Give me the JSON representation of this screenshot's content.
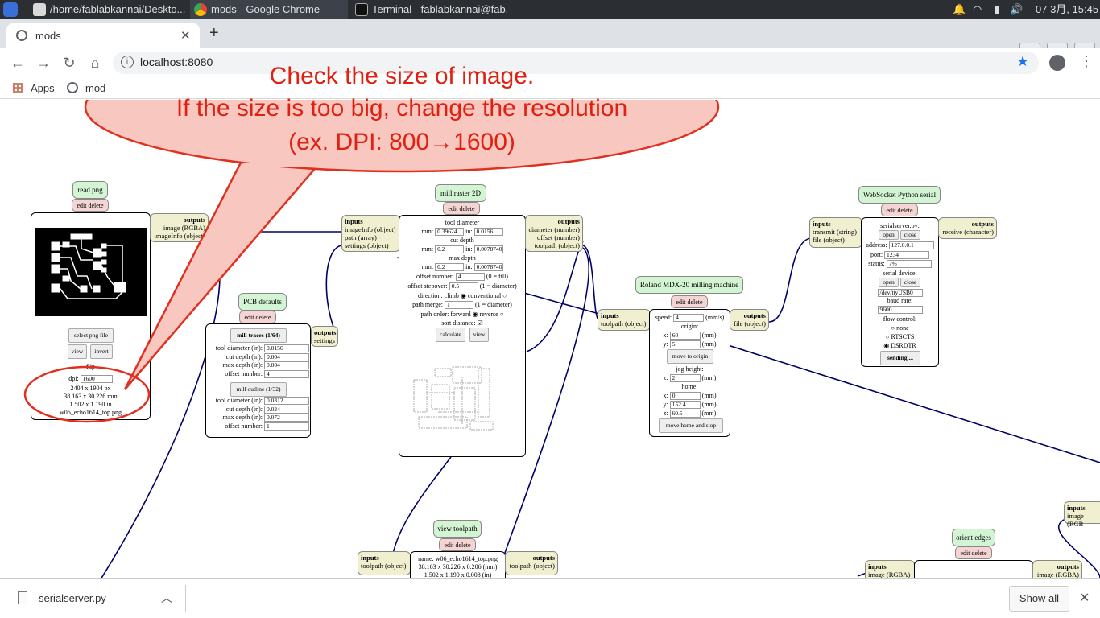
{
  "taskbar": {
    "tasks": [
      {
        "label": "/home/fablabkannai/Deskto..."
      },
      {
        "label": "mods - Google Chrome"
      },
      {
        "label": "Terminal - fablabkannai@fab..."
      }
    ],
    "clock": "07 3月, 15:45"
  },
  "browser": {
    "tab_title": "mods",
    "url": "localhost:8080",
    "bookmarks": [
      {
        "label": "Apps"
      },
      {
        "label": "mod"
      }
    ]
  },
  "callout": {
    "line1": "Check the size of image.",
    "line2": "If the size is too big, change the resolution",
    "line3": "(ex. DPI: 800→1600)",
    "fill": "#f8c8c0",
    "stroke": "#e03020",
    "text_color": "#e02010"
  },
  "modules": {
    "read_png": {
      "title": "read png",
      "edit": "edit delete",
      "outputs_label": "outputs",
      "outputs": [
        "image (RGBA)",
        "imageInfo (object)"
      ],
      "select_btn": "select png file",
      "view_btn": "view",
      "invert_btn": "invert",
      "flip_btn": "flip",
      "dpi_label": "dpi:",
      "dpi_value": "1600",
      "px": "2404 x 1904 px",
      "mm": "38.163 x 30.226 mm",
      "in": "1.502 x 1.190 in",
      "filename": "w06_echo1614_top.png"
    },
    "pcb": {
      "title": "PCB defaults",
      "edit": "edit delete",
      "outputs_label": "outputs",
      "outputs": [
        "settings"
      ],
      "traces_btn": "mill traces (1/64)",
      "outline_btn": "mill outline (1/32)",
      "rows1": [
        {
          "label": "tool diameter (in):",
          "value": "0.0156"
        },
        {
          "label": "cut depth (in):",
          "value": "0.004"
        },
        {
          "label": "max depth (in):",
          "value": "0.004"
        },
        {
          "label": "offset number:",
          "value": "4"
        }
      ],
      "rows2": [
        {
          "label": "tool diameter (in):",
          "value": "0.0312"
        },
        {
          "label": "cut depth (in):",
          "value": "0.024"
        },
        {
          "label": "max depth (in):",
          "value": "0.072"
        },
        {
          "label": "offset number:",
          "value": "1"
        }
      ]
    },
    "raster": {
      "title": "mill raster 2D",
      "edit": "edit delete",
      "inputs_label": "inputs",
      "inputs": [
        "imageInfo (object)",
        "path (array)",
        "settings (object)"
      ],
      "outputs_label": "outputs",
      "outputs": [
        "diameter (number)",
        "offset (number)",
        "toolpath (object)"
      ],
      "tool_diameter": "tool diameter",
      "td_mm": "0.39624",
      "td_in": "0.0156",
      "cut_depth": "cut depth",
      "cd_mm": "0.2",
      "cd_in": "0.0078740",
      "max_depth": "max depth",
      "md_mm": "0.2",
      "md_in": "0.0078740",
      "mm_label": "mm:",
      "in_label": "in:",
      "offset_number_label": "offset number:",
      "offset_number": "4",
      "offset_number_hint": "(0 = fill)",
      "stepover_label": "offset stepover:",
      "stepover": "0.5",
      "stepover_hint": "(1 = diameter)",
      "direction": "direction: climb",
      "conventional": "conventional",
      "merge_label": "path merge:",
      "merge": "1",
      "merge_hint": "(1 = diameter)",
      "order": "path order: forward",
      "reverse": "reverse",
      "sort": "sort distance:",
      "calculate_btn": "calculate",
      "view_btn": "view"
    },
    "roland": {
      "title": "Roland MDX-20 milling machine",
      "edit": "edit delete",
      "inputs_label": "inputs",
      "inputs": [
        "toolpath (object)"
      ],
      "outputs_label": "outputs",
      "outputs": [
        "file (object)"
      ],
      "speed_label": "speed:",
      "speed": "4",
      "speed_unit": "(mm/s)",
      "origin": "origin:",
      "ox": "60",
      "oy": "5",
      "move_origin_btn": "move to origin",
      "jog": "jog height:",
      "jz": "2",
      "home": "home:",
      "hx": "0",
      "hy": "152.4",
      "hz": "60.5",
      "move_home_btn": "move home and stop",
      "x": "x:",
      "y": "y:",
      "z": "z:",
      "mm": "(mm)"
    },
    "websocket": {
      "title": "WebSocket Python serial",
      "edit": "edit delete",
      "inputs_label": "inputs",
      "inputs": [
        "transmit (string)",
        "file (object)"
      ],
      "outputs_label": "outputs",
      "outputs": [
        "receive (character)"
      ],
      "server": "serialserver.py:",
      "open": "open",
      "close": "close",
      "address_label": "address:",
      "address": "127.0.0.1",
      "port_label": "port:",
      "port": "1234",
      "status_label": "status:",
      "status": "7%",
      "device": "serial device:",
      "device_value": "/dev/ttyUSB0",
      "baud": "baud rate:",
      "baud_value": "9600",
      "flow": "flow control:",
      "none": "none",
      "rtscts": "RTSCTS",
      "dsrdtr": "DSRDTR",
      "sending": "sending ..."
    },
    "view_toolpath": {
      "title": "view toolpath",
      "edit": "edit delete",
      "inputs_label": "inputs",
      "inputs": [
        "toolpath (object)"
      ],
      "outputs_label": "outputs",
      "outputs": [
        "toolpath (object)"
      ],
      "name": "name: w06_echo1614_top.png",
      "mm": "38.163 x 30.226 x 0.206 (mm)",
      "in": "1.502 x 1.190 x 0.008 (in)"
    },
    "orient": {
      "title": "orient edges",
      "edit": "edit delete",
      "inputs_label": "inputs",
      "inputs": [
        "image (RGBA)"
      ],
      "outputs_label": "outputs",
      "outputs": [
        "image (RGBA)"
      ]
    },
    "right_partial": {
      "inputs_label": "inputs",
      "inputs": [
        "image (RGB"
      ]
    }
  },
  "downloads": {
    "file": "serialserver.py",
    "show_all": "Show all"
  }
}
